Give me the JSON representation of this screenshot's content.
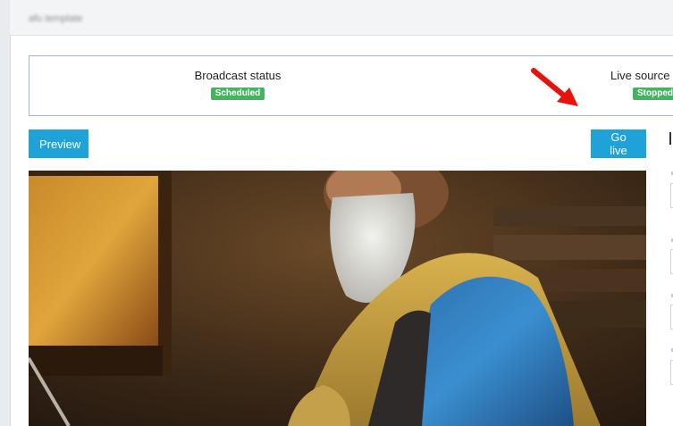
{
  "header": {
    "title": "afu template"
  },
  "status_panel": {
    "broadcast": {
      "label": "Broadcast status",
      "badge": "Scheduled"
    },
    "live_source": {
      "label": "Live source s",
      "badge": "Stopped"
    }
  },
  "buttons": {
    "preview": "Preview",
    "go_live": "Go live"
  },
  "colors": {
    "primary": "#1fa2d8",
    "success": "#44b55e",
    "arrow": "#e8120c"
  }
}
